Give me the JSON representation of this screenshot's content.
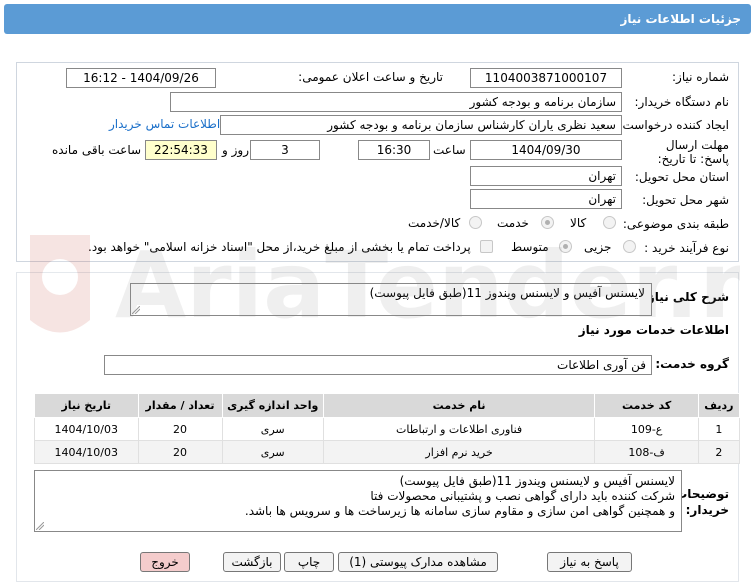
{
  "page": {
    "title": "جزئیات اطلاعات نیاز"
  },
  "info": {
    "need_number_label": "شماره نیاز:",
    "need_number": "1104003871000107",
    "announce_label": "تاریخ و ساعت اعلان عمومی:",
    "announce_value": "1404/09/26 - 16:12",
    "buyer_org_label": "نام دستگاه خریدار:",
    "buyer_org": "سازمان برنامه و بودجه کشور",
    "creator_label": "ایجاد کننده درخواست:",
    "creator": "سعید نظری یاران کارشناس سازمان برنامه و بودجه کشور",
    "contact_link": "اطلاعات تماس خریدار",
    "deadline_label": "مهلت ارسال پاسخ: تا تاریخ:",
    "deadline_date": "1404/09/30",
    "time_label": "ساعت",
    "deadline_time": "16:30",
    "days_value": "3",
    "days_label": "روز و",
    "remaining_time": "22:54:33",
    "remaining_label": "ساعت باقی مانده",
    "province_label": "استان محل تحویل:",
    "province": "تهران",
    "city_label": "شهر محل تحویل:",
    "city": "تهران",
    "category_label": "طبقه بندی موضوعی:",
    "category_options": [
      "کالا",
      "خدمت",
      "کالا/خدمت"
    ],
    "category_selected": "خدمت",
    "process_label": "نوع فرآیند خرید :",
    "process_options": [
      "جزیی",
      "متوسط"
    ],
    "process_selected": "متوسط",
    "payment_note": "پرداخت تمام یا بخشی از مبلغ خرید،از محل \"اسناد خزانه اسلامی\" خواهد بود."
  },
  "summary": {
    "label": "شرح کلی نیاز:",
    "text": "لایسنس آفیس و لایسنس ویندوز 11(طبق فایل پیوست)"
  },
  "services": {
    "section_title": "اطلاعات خدمات مورد نیاز",
    "group_label": "گروه خدمت:",
    "group_value": "فن آوری اطلاعات",
    "columns": [
      "ردیف",
      "کد خدمت",
      "نام خدمت",
      "واحد اندازه گیری",
      "تعداد / مقدار",
      "تاریخ نیاز"
    ],
    "rows": [
      [
        "1",
        "ع-109",
        "فناوری اطلاعات و ارتباطات",
        "سری",
        "20",
        "1404/10/03"
      ],
      [
        "2",
        "ف-108",
        "خرید نرم افزار",
        "سری",
        "20",
        "1404/10/03"
      ]
    ]
  },
  "buyer_notes": {
    "label": "توضیحات خریدار:",
    "lines": [
      "لایسنس آفیس و لایسنس ویندوز 11(طبق فایل پیوست)",
      "شرکت کننده باید دارای گواهی نصب و پشتیبانی محصولات فتا",
      "و همچنین گواهی امن سازی و مقاوم سازی سامانه ها زیرساخت ها و سرویس ها باشد."
    ]
  },
  "buttons": {
    "reply": "پاسخ به نیاز",
    "attachments": "مشاهده مدارک پیوستی (1)",
    "print": "چاپ",
    "back": "بازگشت",
    "exit": "خروج"
  },
  "watermark": {
    "text": "AriaTender.neT"
  },
  "colors": {
    "header": "#5b9bd5",
    "remaining_bg": "#ffffcc",
    "exit_bg": "#f4cccc",
    "link": "#1a6fc9"
  }
}
